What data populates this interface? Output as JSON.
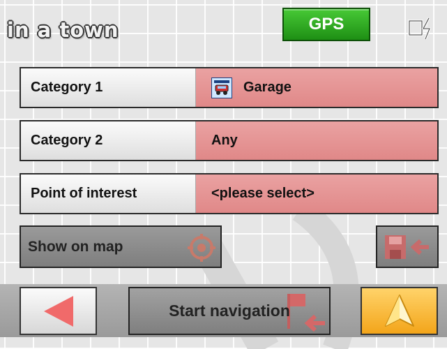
{
  "header": {
    "title": "in a town",
    "gps_label": "GPS"
  },
  "rows": [
    {
      "label": "Category 1",
      "value": "Garage",
      "icon": "car-repair-icon"
    },
    {
      "label": "Category 2",
      "value": "Any"
    },
    {
      "label": "Point of interest",
      "value": "<please select>"
    }
  ],
  "actions": {
    "show_on_map": "Show on map",
    "start_navigation": "Start navigation"
  },
  "colors": {
    "gps_green": "#2fb520",
    "value_pink": "#e89898",
    "go_orange": "#f7b12c",
    "arrow_red": "#f06a6a"
  },
  "icons": {
    "power": "power-icon",
    "target": "target-icon",
    "save": "save-to-favorites-icon",
    "back": "back-arrow-icon",
    "flag": "destination-flag-icon",
    "go": "navigation-arrow-icon"
  }
}
